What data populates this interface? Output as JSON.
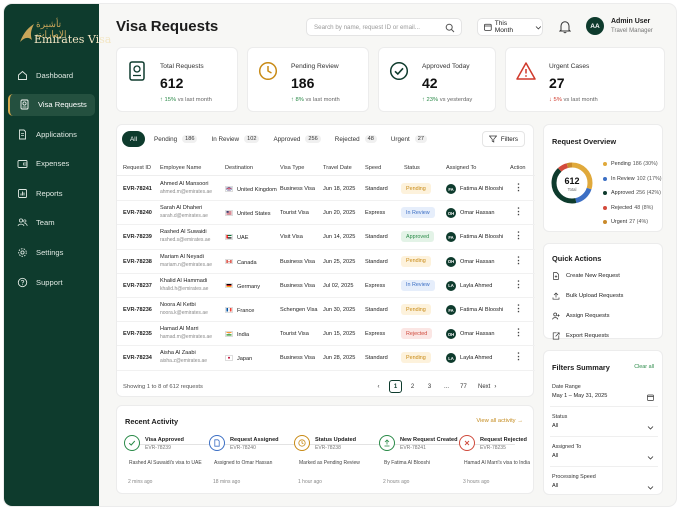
{
  "brand": {
    "arabic": "تأشيرة الإمارات",
    "name": "Emirates Visa"
  },
  "nav": [
    {
      "label": "Dashboard",
      "icon": "home-icon",
      "active": false
    },
    {
      "label": "Visa Requests",
      "icon": "passport-icon",
      "active": true
    },
    {
      "label": "Applications",
      "icon": "document-icon",
      "active": false
    },
    {
      "label": "Expenses",
      "icon": "wallet-icon",
      "active": false
    },
    {
      "label": "Reports",
      "icon": "chart-icon",
      "active": false
    },
    {
      "label": "Team",
      "icon": "users-icon",
      "active": false
    },
    {
      "label": "Settings",
      "icon": "gear-icon",
      "active": false
    },
    {
      "label": "Support",
      "icon": "help-icon",
      "active": false
    }
  ],
  "header": {
    "title": "Visa Requests",
    "search_placeholder": "Search by name, request ID or email...",
    "period": "This Month",
    "user": {
      "initials": "AA",
      "name": "Admin User",
      "role": "Travel Manager"
    }
  },
  "stats": [
    {
      "label": "Total Requests",
      "value": "612",
      "change": "15%",
      "change_text": "vs last month",
      "direction": "up",
      "icon": "passport-icon",
      "color": "#0e3b2d"
    },
    {
      "label": "Pending Review",
      "value": "186",
      "change": "8%",
      "change_text": "vs last month",
      "direction": "up",
      "icon": "clock-icon",
      "color": "#c88a15"
    },
    {
      "label": "Approved Today",
      "value": "42",
      "change": "23%",
      "change_text": "vs yesterday",
      "direction": "up",
      "icon": "check-circle-icon",
      "color": "#0e3b2d"
    },
    {
      "label": "Urgent Cases",
      "value": "27",
      "change": "5%",
      "change_text": "vs last month",
      "direction": "down",
      "icon": "warning-icon",
      "color": "#d0392b"
    }
  ],
  "filter_chips": [
    {
      "label": "All",
      "count": "",
      "active": true
    },
    {
      "label": "Pending",
      "count": "186",
      "active": false
    },
    {
      "label": "In Review",
      "count": "102",
      "active": false
    },
    {
      "label": "Approved",
      "count": "256",
      "active": false
    },
    {
      "label": "Rejected",
      "count": "48",
      "active": false
    },
    {
      "label": "Urgent",
      "count": "27",
      "active": false
    }
  ],
  "filters_label": "Filters",
  "table": {
    "columns": [
      "Request ID",
      "Employee Name",
      "Destination",
      "Visa Type",
      "Travel Date",
      "Speed",
      "Status",
      "Assigned To",
      "Action"
    ],
    "rows": [
      {
        "id": "EVR-78241",
        "name": "Ahmed Al Mansoori",
        "email": "ahmed.m@emirates.ae",
        "flag": "uk",
        "destination": "United Kingdom",
        "visa_type": "Business Visa",
        "date": "Jun 18, 2025",
        "speed": "Standard",
        "status": "Pending",
        "status_class": "pending",
        "assignee_initials": "FA",
        "assignee": "Fatima Al Blooshi"
      },
      {
        "id": "EVR-78240",
        "name": "Sarah Al Dhaheri",
        "email": "sarah.d@emirates.ae",
        "flag": "us",
        "destination": "United States",
        "visa_type": "Tourist Visa",
        "date": "Jun 20, 2025",
        "speed": "Express",
        "status": "In Review",
        "status_class": "review",
        "assignee_initials": "OH",
        "assignee": "Omar Hassan"
      },
      {
        "id": "EVR-78239",
        "name": "Rashed Al Suwaidi",
        "email": "rashed.s@emirates.ae",
        "flag": "ae",
        "destination": "UAE",
        "visa_type": "Visit Visa",
        "date": "Jun 14, 2025",
        "speed": "Standard",
        "status": "Approved",
        "status_class": "approved",
        "assignee_initials": "FA",
        "assignee": "Fatima Al Blooshi"
      },
      {
        "id": "EVR-78238",
        "name": "Mariam Al Neyadi",
        "email": "mariam.n@emirates.ae",
        "flag": "ca",
        "destination": "Canada",
        "visa_type": "Business Visa",
        "date": "Jun 25, 2025",
        "speed": "Standard",
        "status": "Pending",
        "status_class": "pending",
        "assignee_initials": "OH",
        "assignee": "Omar Hassan"
      },
      {
        "id": "EVR-78237",
        "name": "Khalid Al Hammadi",
        "email": "khalid.h@emirates.ae",
        "flag": "de",
        "destination": "Germany",
        "visa_type": "Business Visa",
        "date": "Jul 02, 2025",
        "speed": "Express",
        "status": "In Review",
        "status_class": "review",
        "assignee_initials": "LA",
        "assignee": "Layla Ahmed"
      },
      {
        "id": "EVR-78236",
        "name": "Noora Al Ketbi",
        "email": "noora.k@emirates.ae",
        "flag": "fr",
        "destination": "France",
        "visa_type": "Schengen Visa",
        "date": "Jun 30, 2025",
        "speed": "Standard",
        "status": "Pending",
        "status_class": "pending",
        "assignee_initials": "FA",
        "assignee": "Fatima Al Blooshi"
      },
      {
        "id": "EVR-78235",
        "name": "Hamad Al Marri",
        "email": "hamad.m@emirates.ae",
        "flag": "in",
        "destination": "India",
        "visa_type": "Tourist Visa",
        "date": "Jun 15, 2025",
        "speed": "Express",
        "status": "Rejected",
        "status_class": "rejected",
        "assignee_initials": "OH",
        "assignee": "Omar Hassan"
      },
      {
        "id": "EVR-78234",
        "name": "Aisha Al Zaabi",
        "email": "aisha.z@emirates.ae",
        "flag": "jp",
        "destination": "Japan",
        "visa_type": "Business Visa",
        "date": "Jun 28, 2025",
        "speed": "Standard",
        "status": "Pending",
        "status_class": "pending",
        "assignee_initials": "LA",
        "assignee": "Layla Ahmed"
      }
    ],
    "showing": "Showing 1 to 8 of 612 requests"
  },
  "pagination": {
    "pages": [
      "1",
      "2",
      "3",
      "...",
      "77"
    ],
    "active": "1",
    "next": "Next"
  },
  "activity": {
    "title": "Recent Activity",
    "view_all": "View all activity",
    "items": [
      {
        "title": "Visa Approved",
        "id": "EVR-78239",
        "desc": "Rashed Al Suwaidi's visa to UAE",
        "time": "2 mins ago",
        "icon": "check-icon",
        "color": "#2a8a48"
      },
      {
        "title": "Request Assigned",
        "id": "EVR-78240",
        "desc": "Assigned to Omar Hassan",
        "time": "18 mins ago",
        "icon": "file-icon",
        "color": "#3c6fc4"
      },
      {
        "title": "Status Updated",
        "id": "EVR-78238",
        "desc": "Marked as Pending Review",
        "time": "1 hour ago",
        "icon": "clock-icon",
        "color": "#c88a15"
      },
      {
        "title": "New Request Created",
        "id": "EVR-78241",
        "desc": "By Fatima Al Blooshi",
        "time": "2 hours ago",
        "icon": "upload-icon",
        "color": "#2a8a48"
      },
      {
        "title": "Request Rejected",
        "id": "EVR-78235",
        "desc": "Hamad Al Marri's visa to India",
        "time": "3 hours ago",
        "icon": "x-icon",
        "color": "#cf4a3c"
      }
    ]
  },
  "overview": {
    "title": "Request Overview",
    "total_value": "612",
    "total_label": "Total",
    "segments": [
      {
        "label": "Pending",
        "value": 186,
        "display": "186 (30%)",
        "color": "#e0a93b"
      },
      {
        "label": "In Review",
        "value": 102,
        "display": "102 (17%)",
        "color": "#3c6fc4"
      },
      {
        "label": "Approved",
        "value": 256,
        "display": "256 (42%)",
        "color": "#0e3b2d"
      },
      {
        "label": "Rejected",
        "value": 48,
        "display": "48 (8%)",
        "color": "#d34a3c"
      },
      {
        "label": "Urgent",
        "value": 27,
        "display": "27 (4%)",
        "color": "#c98a2b"
      }
    ]
  },
  "quick_actions": {
    "title": "Quick Actions",
    "items": [
      {
        "label": "Create New Request",
        "icon": "plus-doc-icon"
      },
      {
        "label": "Bulk Upload Requests",
        "icon": "upload-icon"
      },
      {
        "label": "Assign Requests",
        "icon": "user-assign-icon"
      },
      {
        "label": "Export Requests",
        "icon": "export-icon"
      }
    ]
  },
  "filters_summary": {
    "title": "Filters Summary",
    "clear": "Clear all",
    "items": [
      {
        "label": "Date Range",
        "value": "May 1 – May 31, 2025",
        "control": "calendar-icon"
      },
      {
        "label": "Status",
        "value": "All",
        "control": "chevron-down-icon"
      },
      {
        "label": "Assigned To",
        "value": "All",
        "control": "chevron-down-icon"
      },
      {
        "label": "Processing Speed",
        "value": "All",
        "control": "chevron-down-icon"
      }
    ]
  }
}
